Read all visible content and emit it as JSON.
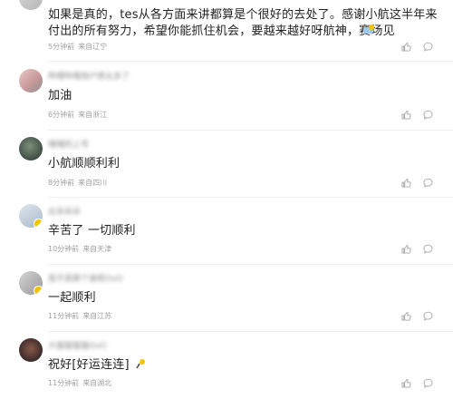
{
  "comments": [
    {
      "username": "",
      "content": "如果是真的，tes从各方面来讲都算是个很好的去处了。感谢小航这半年来付出的所有努力，希望你能抓住机会，要越来越好呀航神，赛场见",
      "time": "5分钟前",
      "location": "来自辽宁"
    },
    {
      "username": "哔哩哔哩用户想太多了",
      "content": "加油",
      "time": "6分钟前",
      "location": "来自浙江"
    },
    {
      "username": "喵喵的上号",
      "content": "小航顺顺利利",
      "time": "8分钟前",
      "location": "来自四川"
    },
    {
      "username": "云朵朵朵",
      "content": "辛苦了 一切顺利",
      "time": "10分钟前",
      "location": "来自天津"
    },
    {
      "username": "我不是那个谁呢OvO",
      "content": "一起顺利",
      "time": "11分钟前",
      "location": "来自江苏"
    },
    {
      "username": "大猫猫猫猫OvO",
      "content": "祝好[好运连连]",
      "time": "11分钟前",
      "location": "来自湖北"
    }
  ],
  "icons": {
    "like": "thumbs-up-icon",
    "reply": "reply-bubble-icon"
  },
  "colors": {
    "text": "#222222",
    "meta": "#a0a0a0",
    "icon": "#a9a9a9",
    "divider": "#f0f0f0"
  }
}
